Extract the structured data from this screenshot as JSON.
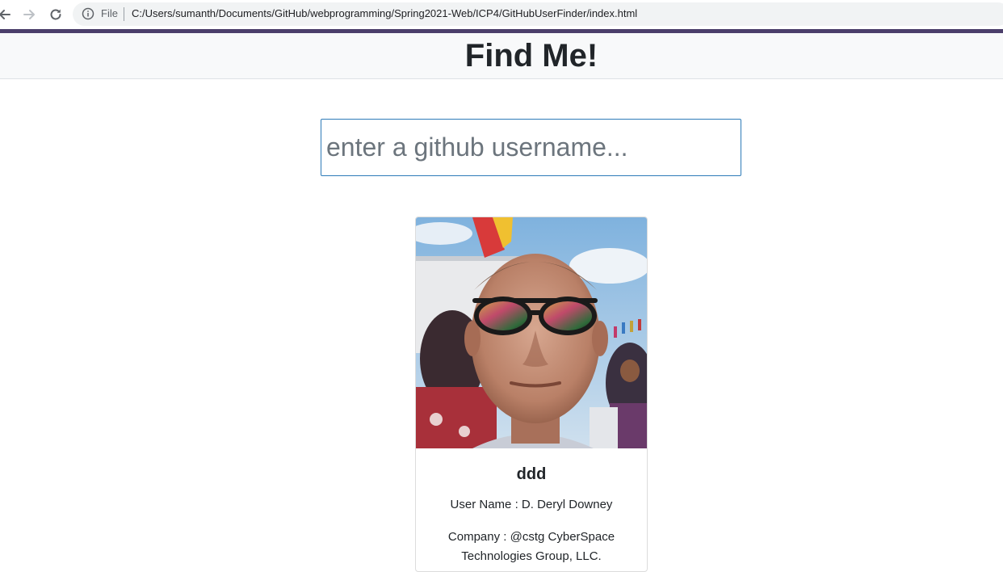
{
  "browser": {
    "scheme_label": "File",
    "url": "C:/Users/sumanth/Documents/GitHub/webprogramming/Spring2021-Web/ICP4/GitHubUserFinder/index.html",
    "icons": [
      "back-arrow-icon",
      "forward-arrow-icon",
      "reload-icon",
      "info-icon"
    ]
  },
  "header": {
    "title": "Find Me!"
  },
  "search": {
    "placeholder": "enter a github username...",
    "value": ""
  },
  "user_card": {
    "login": "ddd",
    "name_label": "User Name : D. Deryl Downey",
    "company_label": "Company : @cstg CyberSpace Technologies Group, LLC."
  },
  "colors": {
    "accent_strip": "#4b3f6b",
    "input_border": "#2e7bb8",
    "header_bg": "#f8f9fa"
  }
}
